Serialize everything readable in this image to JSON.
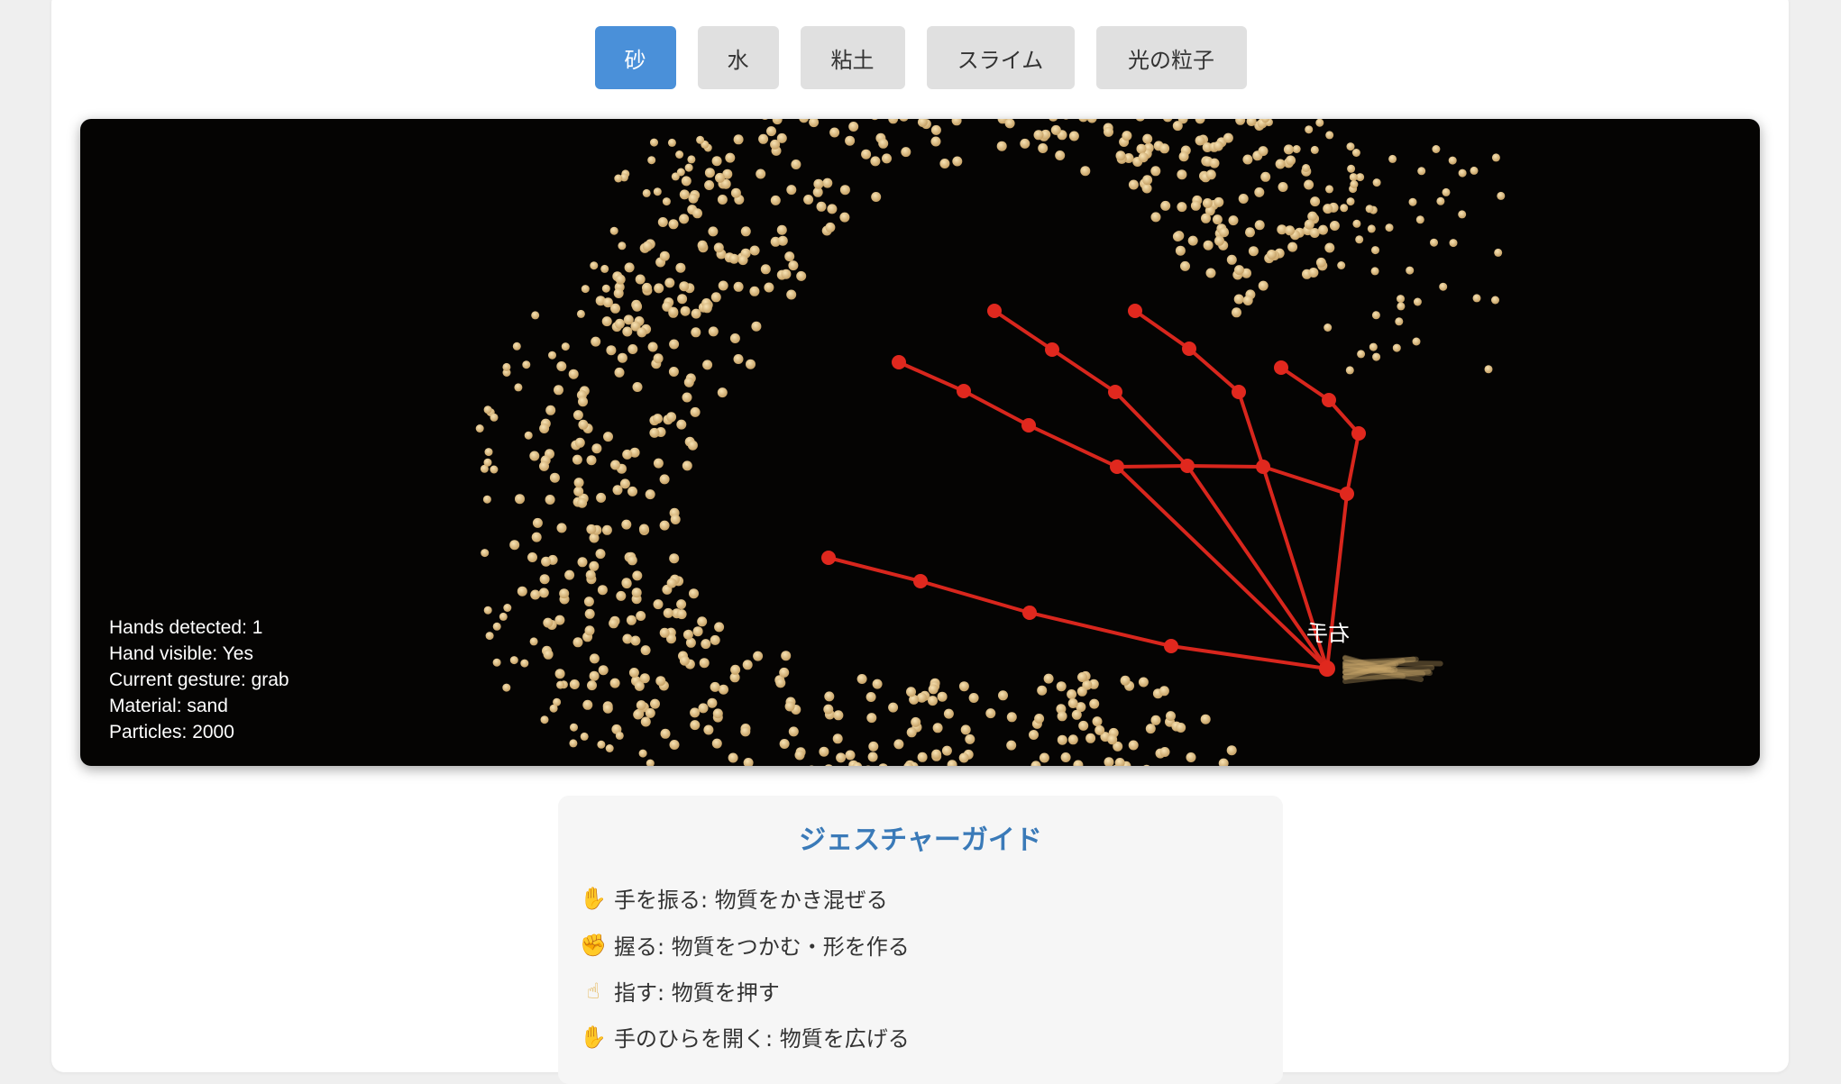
{
  "materials": [
    {
      "label": "砂",
      "active": true
    },
    {
      "label": "水",
      "active": false
    },
    {
      "label": "粘土",
      "active": false
    },
    {
      "label": "スライム",
      "active": false
    },
    {
      "label": "光の粒子",
      "active": false
    }
  ],
  "hud": {
    "hands_detected": "Hands detected: 1",
    "hand_visible": "Hand visible: Yes",
    "current_gesture": "Current gesture: grab",
    "material": "Material: sand",
    "particles": "Particles: 2000"
  },
  "hand_label": "右手",
  "colors": {
    "active_button": "#4a90d9",
    "button": "#e0e0e0",
    "particle": "#e8c98e",
    "skeleton": "#e0281e",
    "guide_title": "#3a7ab8"
  },
  "guide": {
    "title": "ジェスチャーガイド",
    "items": [
      {
        "icon": "waving-hand-icon",
        "text": "手を振る: 物質をかき混ぜる"
      },
      {
        "icon": "fist-icon",
        "text": "握る: 物質をつかむ・形を作る"
      },
      {
        "icon": "pointing-finger-icon",
        "text": "指す: 物質を押す"
      },
      {
        "icon": "open-palm-icon",
        "text": "手のひらを開く: 物質を広げる"
      }
    ]
  }
}
